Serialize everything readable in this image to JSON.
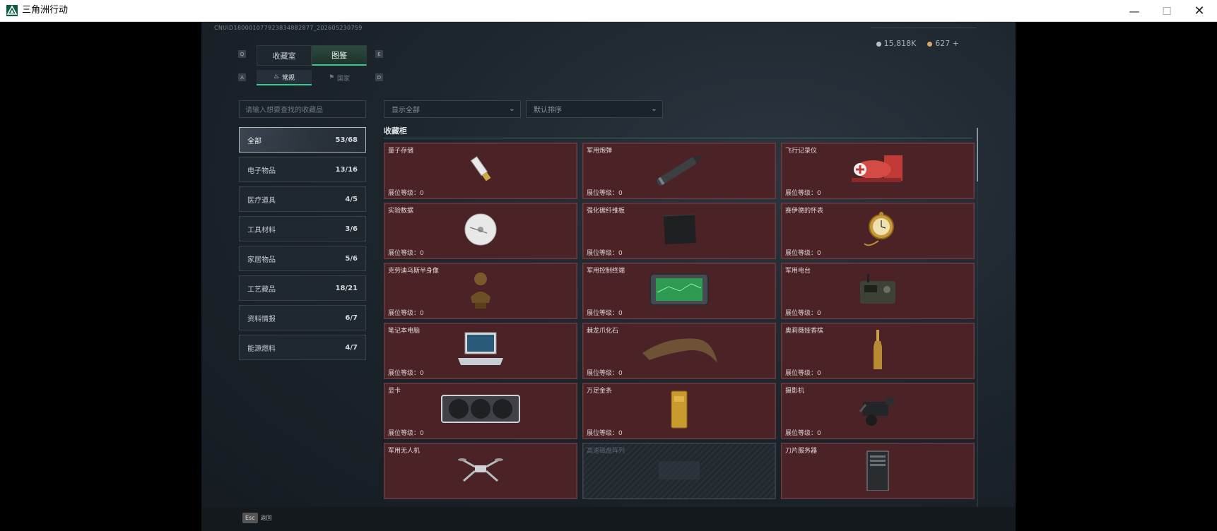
{
  "window": {
    "title": "三角洲行动",
    "min": "—",
    "max": "☐",
    "close": "✕"
  },
  "header": {
    "uid": "CNUID18000107792383488​2877_202605230759",
    "currency": [
      {
        "value": "15,818K",
        "color": "#b9c0c6"
      },
      {
        "value": "627 +",
        "color": "#d9a866"
      }
    ]
  },
  "keys": {
    "q": "Q",
    "e": "E",
    "a": "A",
    "d": "D"
  },
  "tabs": [
    {
      "label": "收藏室",
      "active": false
    },
    {
      "label": "图鉴",
      "active": true
    }
  ],
  "subtabs": [
    {
      "label": "常规",
      "icon": "flame-icon",
      "active": true
    },
    {
      "label": "国家",
      "icon": "flag-icon",
      "active": false
    }
  ],
  "search": {
    "placeholder": "请输入想要查找的收藏品"
  },
  "categories": [
    {
      "label": "全部",
      "count": "53/68",
      "active": true
    },
    {
      "label": "电子物品",
      "count": "13/16"
    },
    {
      "label": "医疗道具",
      "count": "4/5"
    },
    {
      "label": "工具材料",
      "count": "3/6"
    },
    {
      "label": "家居物品",
      "count": "5/6"
    },
    {
      "label": "工艺藏品",
      "count": "18/21"
    },
    {
      "label": "资料情报",
      "count": "6/7"
    },
    {
      "label": "能源燃料",
      "count": "4/7"
    }
  ],
  "filters": {
    "show": "显示全部",
    "sort": "默认排序"
  },
  "section": {
    "title": "收藏柜"
  },
  "level_prefix": "展位等级：",
  "items": [
    {
      "name": "量子存储",
      "level": "0",
      "icon": "usb-drive-icon"
    },
    {
      "name": "军用炮弹",
      "level": "0",
      "icon": "artillery-shell-icon"
    },
    {
      "name": "飞行记录仪",
      "level": "0",
      "icon": "flight-recorder-icon"
    },
    {
      "name": "实验数据",
      "level": "0",
      "icon": "disc-icon"
    },
    {
      "name": "强化碳纤维板",
      "level": "0",
      "icon": "carbon-plate-icon"
    },
    {
      "name": "赛伊德的怀表",
      "level": "0",
      "icon": "pocket-watch-icon"
    },
    {
      "name": "克劳迪乌斯半身像",
      "level": "0",
      "icon": "bust-icon"
    },
    {
      "name": "军用控制终端",
      "level": "0",
      "icon": "control-terminal-icon"
    },
    {
      "name": "军用电台",
      "level": "0",
      "icon": "radio-icon"
    },
    {
      "name": "笔记本电脑",
      "level": "0",
      "icon": "laptop-icon"
    },
    {
      "name": "棘龙爪化石",
      "level": "0",
      "icon": "claw-fossil-icon"
    },
    {
      "name": "奥莉薇娅香槟",
      "level": "0",
      "icon": "champagne-icon"
    },
    {
      "name": "显卡",
      "level": "0",
      "icon": "gpu-icon"
    },
    {
      "name": "万足金条",
      "level": "0",
      "icon": "gold-bar-icon"
    },
    {
      "name": "摄影机",
      "level": "0",
      "icon": "camera-icon"
    },
    {
      "name": "军用无人机",
      "level": "",
      "icon": "drone-icon"
    },
    {
      "name": "高速磁盘阵列",
      "level": "",
      "icon": "disk-array-icon",
      "locked": true
    },
    {
      "name": "刀片服务器",
      "level": "",
      "icon": "blade-server-icon"
    }
  ],
  "footer": {
    "esc_key": "Esc",
    "esc_label": "返回"
  }
}
